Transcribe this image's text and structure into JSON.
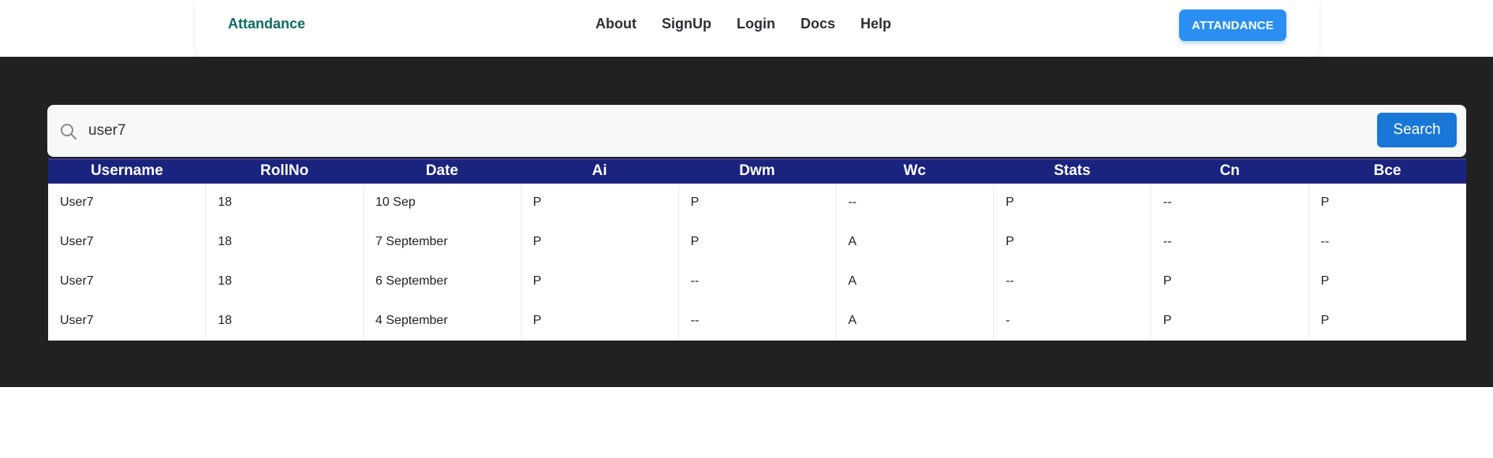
{
  "navbar": {
    "brand": "Attandance",
    "links": [
      "About",
      "SignUp",
      "Login",
      "Docs",
      "Help"
    ],
    "cta_label": "ATTANDANCE"
  },
  "search": {
    "value": "user7",
    "button_label": "Search",
    "icon": "search-icon"
  },
  "table": {
    "headers": [
      "Username",
      "RollNo",
      "Date",
      "Ai",
      "Dwm",
      "Wc",
      "Stats",
      "Cn",
      "Bce"
    ],
    "rows": [
      [
        "User7",
        "18",
        "10 Sep",
        "P",
        "P",
        "--",
        "P",
        "--",
        "P"
      ],
      [
        "User7",
        "18",
        "7 September",
        "P",
        "P",
        "A",
        "P",
        "--",
        "--"
      ],
      [
        "User7",
        "18",
        "6 September",
        "P",
        "--",
        "A",
        "--",
        "P",
        "P"
      ],
      [
        "User7",
        "18",
        "4 September",
        "P",
        "--",
        "A",
        "-",
        "P",
        "P"
      ]
    ]
  },
  "colors": {
    "brand": "#0b6b62",
    "cta": "#2a8ff0",
    "dark_bg": "#212121",
    "table_header": "#1a237e",
    "search_button": "#1877d7"
  }
}
